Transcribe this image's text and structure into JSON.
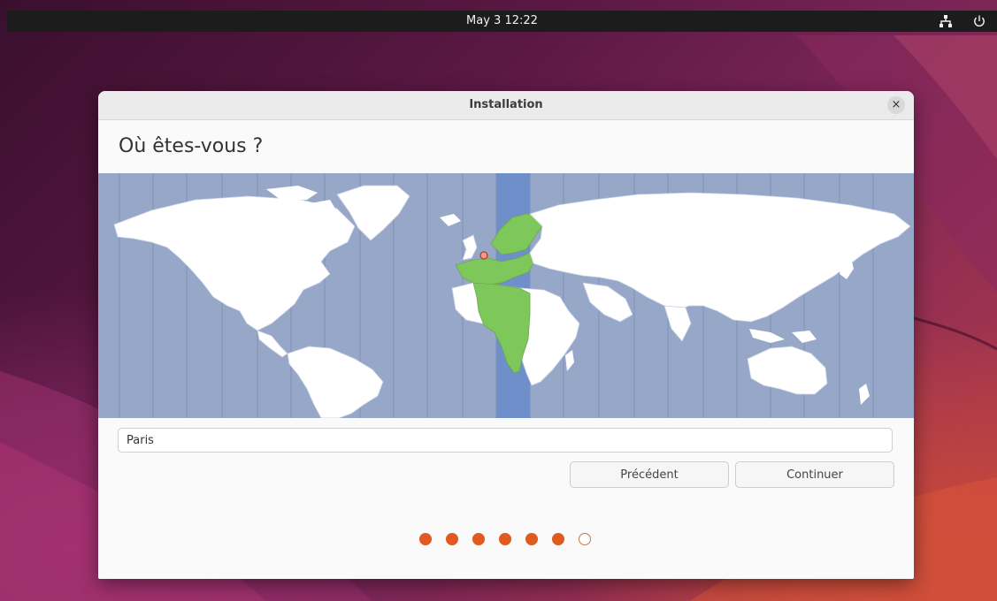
{
  "topbar": {
    "clock": "May 3  12:22",
    "network_icon": "network-icon",
    "power_icon": "power-icon"
  },
  "window": {
    "title": "Installation",
    "close_label": "×",
    "heading": "Où êtes-vous ?",
    "location_value": "Paris",
    "buttons": {
      "previous": "Précédent",
      "next": "Continuer"
    },
    "progress": {
      "completed_steps": 6,
      "total_steps": 7
    }
  },
  "colors": {
    "accent": "#e05a21",
    "map_ocean": "#97a7c8",
    "map_selected_band": "#6f8fcb",
    "map_selected_zone": "#7ec75a",
    "topbar": "#1c1c1c"
  }
}
